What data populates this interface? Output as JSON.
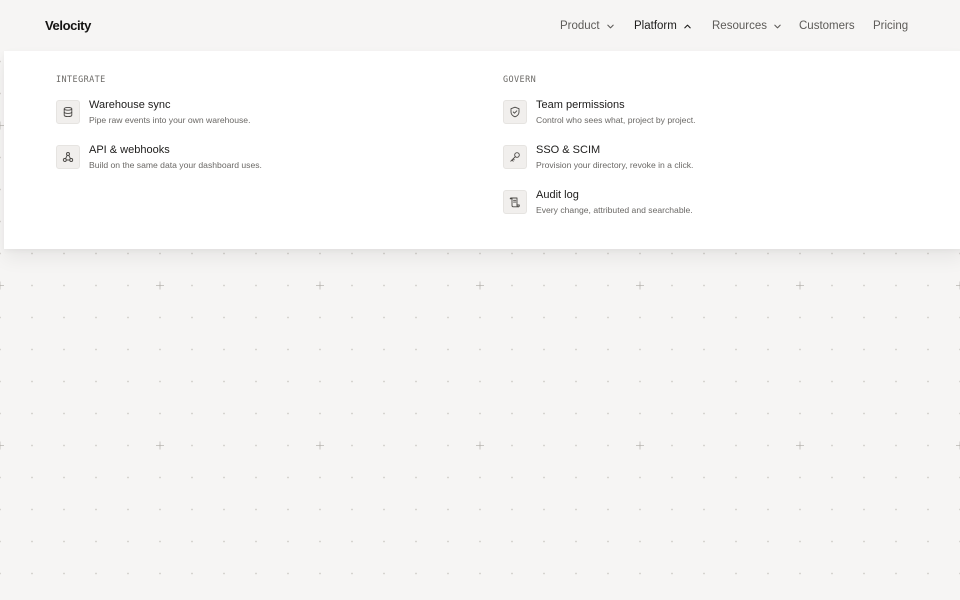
{
  "brand": {
    "logo_text": "Velocity"
  },
  "nav": {
    "items": [
      {
        "label": "Product",
        "has_chevron": true,
        "expanded": false
      },
      {
        "label": "Platform",
        "has_chevron": true,
        "expanded": true
      },
      {
        "label": "Resources",
        "has_chevron": true,
        "expanded": false
      },
      {
        "label": "Customers",
        "has_chevron": false
      },
      {
        "label": "Pricing",
        "has_chevron": false
      }
    ]
  },
  "dropdown": {
    "columns": [
      {
        "title": "INTEGRATE",
        "items": [
          {
            "icon": "database-icon",
            "title": "Warehouse sync",
            "description": "Pipe raw events into your own warehouse."
          },
          {
            "icon": "webhook-icon",
            "title": "API & webhooks",
            "description": "Build on the same data your dashboard uses."
          }
        ]
      },
      {
        "title": "GOVERN",
        "items": [
          {
            "icon": "shield-check-icon",
            "title": "Team permissions",
            "description": "Control who sees what, project by project."
          },
          {
            "icon": "key-icon",
            "title": "SSO & SCIM",
            "description": "Provision your directory, revoke in a click."
          },
          {
            "icon": "scroll-icon",
            "title": "Audit log",
            "description": "Every change, attributed and searchable."
          }
        ]
      }
    ]
  },
  "colors": {
    "page_background": "#f6f5f4",
    "panel_background": "#ffffff",
    "text_primary": "#1d1c1b",
    "text_secondary": "#6a6865",
    "icon_tile": "#f1efed",
    "pattern_dot": "#cfccc8"
  }
}
